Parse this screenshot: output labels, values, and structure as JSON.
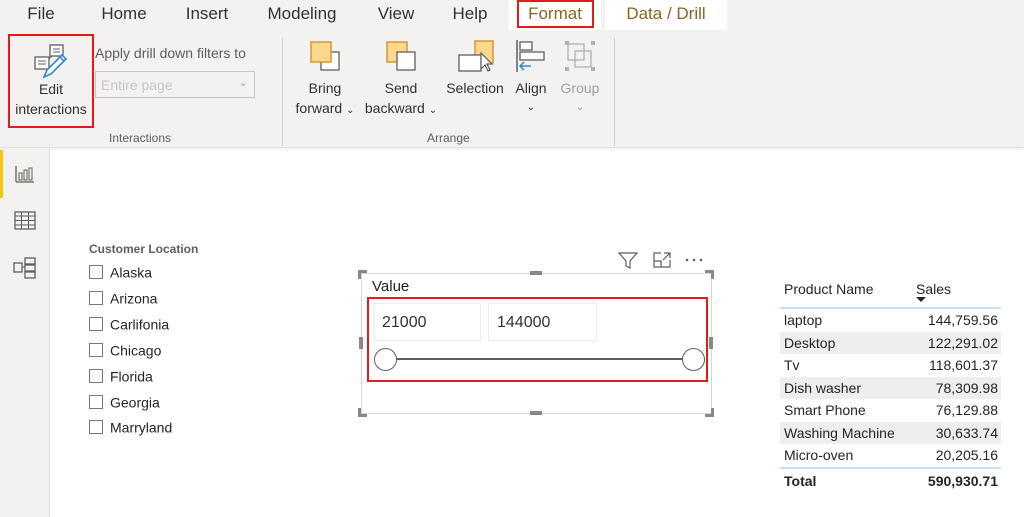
{
  "menu": {
    "tabs": [
      {
        "label": "File"
      },
      {
        "label": "Home"
      },
      {
        "label": "Insert"
      },
      {
        "label": "Modeling"
      },
      {
        "label": "View"
      },
      {
        "label": "Help"
      },
      {
        "label": "Format"
      },
      {
        "label": "Data / Drill"
      }
    ],
    "active_tab": "Format",
    "active_color": "#8a6422",
    "highlight_color": "#e21b1b"
  },
  "ribbon": {
    "interactions": {
      "edit_interactions_line1": "Edit",
      "edit_interactions_line2": "interactions",
      "apply_label": "Apply drill down filters to",
      "dropdown_value": "Entire page",
      "group_label": "Interactions"
    },
    "arrange": {
      "bring_forward_line1": "Bring",
      "bring_forward_line2": "forward",
      "send_backward_line1": "Send",
      "send_backward_line2": "backward",
      "selection": "Selection",
      "align": "Align",
      "group": "Group",
      "group_label": "Arrange"
    }
  },
  "leftnav": {
    "items": [
      {
        "icon": "report-view-icon",
        "active": true
      },
      {
        "icon": "data-view-icon",
        "active": false
      },
      {
        "icon": "model-view-icon",
        "active": false
      }
    ],
    "accent": "#f2c811"
  },
  "slicer": {
    "title": "Customer Location",
    "items": [
      "Alaska",
      "Arizona",
      "Carlifonia",
      "Chicago",
      "Florida",
      "Georgia",
      "Marryland"
    ]
  },
  "range_slicer": {
    "title": "Value",
    "min_value": "21000",
    "max_value": "144000",
    "slider_low_fraction": 0,
    "slider_high_fraction": 1
  },
  "table": {
    "headers": [
      "Product Name",
      "Sales"
    ],
    "sort_column": "Sales",
    "sort_direction": "descending",
    "rows": [
      {
        "name": "laptop",
        "sales": "144,759.56"
      },
      {
        "name": "Desktop",
        "sales": "122,291.02"
      },
      {
        "name": "Tv",
        "sales": "118,601.37"
      },
      {
        "name": "Dish washer",
        "sales": "78,309.98"
      },
      {
        "name": "Smart Phone",
        "sales": "76,129.88"
      },
      {
        "name": "Washing Machine",
        "sales": "30,633.74"
      },
      {
        "name": "Micro-oven",
        "sales": "20,205.16"
      }
    ],
    "total_label": "Total",
    "total_value": "590,930.71"
  }
}
